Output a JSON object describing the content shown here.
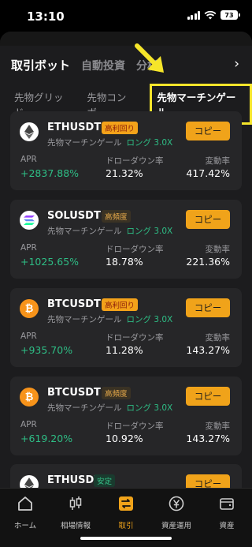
{
  "status": {
    "time": "13:10",
    "battery": "73"
  },
  "top_tabs": [
    "取引ボット",
    "自動投資",
    "分析"
  ],
  "sub_tabs": [
    "先物グリッド",
    "先物コンボ",
    "先物マーチンゲール"
  ],
  "cards": [
    {
      "pair": "ETHUSDT",
      "badge": "高利回り",
      "coin": "ETH",
      "strategy": "先物マーチンゲール",
      "leverage": "ロング 3.0X",
      "copy": "コピー",
      "apr_label": "APR",
      "apr": "+2837.88%",
      "dd_label": "ドローダウン率",
      "dd": "21.32%",
      "vol_label": "変動率",
      "vol": "417.42%"
    },
    {
      "pair": "SOLUSDT",
      "badge": "高頻度",
      "coin": "SOL",
      "strategy": "先物マーチンゲール",
      "leverage": "ロング 3.0X",
      "copy": "コピー",
      "apr_label": "APR",
      "apr": "+1025.65%",
      "dd_label": "ドローダウン率",
      "dd": "18.78%",
      "vol_label": "変動率",
      "vol": "221.36%"
    },
    {
      "pair": "BTCUSDT",
      "badge": "高利回り",
      "coin": "BTC",
      "strategy": "先物マーチンゲール",
      "leverage": "ロング 3.0X",
      "copy": "コピー",
      "apr_label": "APR",
      "apr": "+935.70%",
      "dd_label": "ドローダウン率",
      "dd": "11.28%",
      "vol_label": "変動率",
      "vol": "143.27%"
    },
    {
      "pair": "BTCUSDT",
      "badge": "高頻度",
      "coin": "BTC",
      "strategy": "先物マーチンゲール",
      "leverage": "ロング 3.0X",
      "copy": "コピー",
      "apr_label": "APR",
      "apr": "+619.20%",
      "dd_label": "ドローダウン率",
      "dd": "10.92%",
      "vol_label": "変動率",
      "vol": "143.27%"
    }
  ],
  "partial_card": {
    "pair": "ETHUSDT",
    "badge": "安定",
    "copy": "コピー"
  },
  "bottom_nav": [
    "ホーム",
    "相場情報",
    "取引",
    "資産運用",
    "資産"
  ],
  "colors": {
    "accent": "#f0a31a",
    "positive": "#2ebd85",
    "highlight": "#f5e52a"
  }
}
